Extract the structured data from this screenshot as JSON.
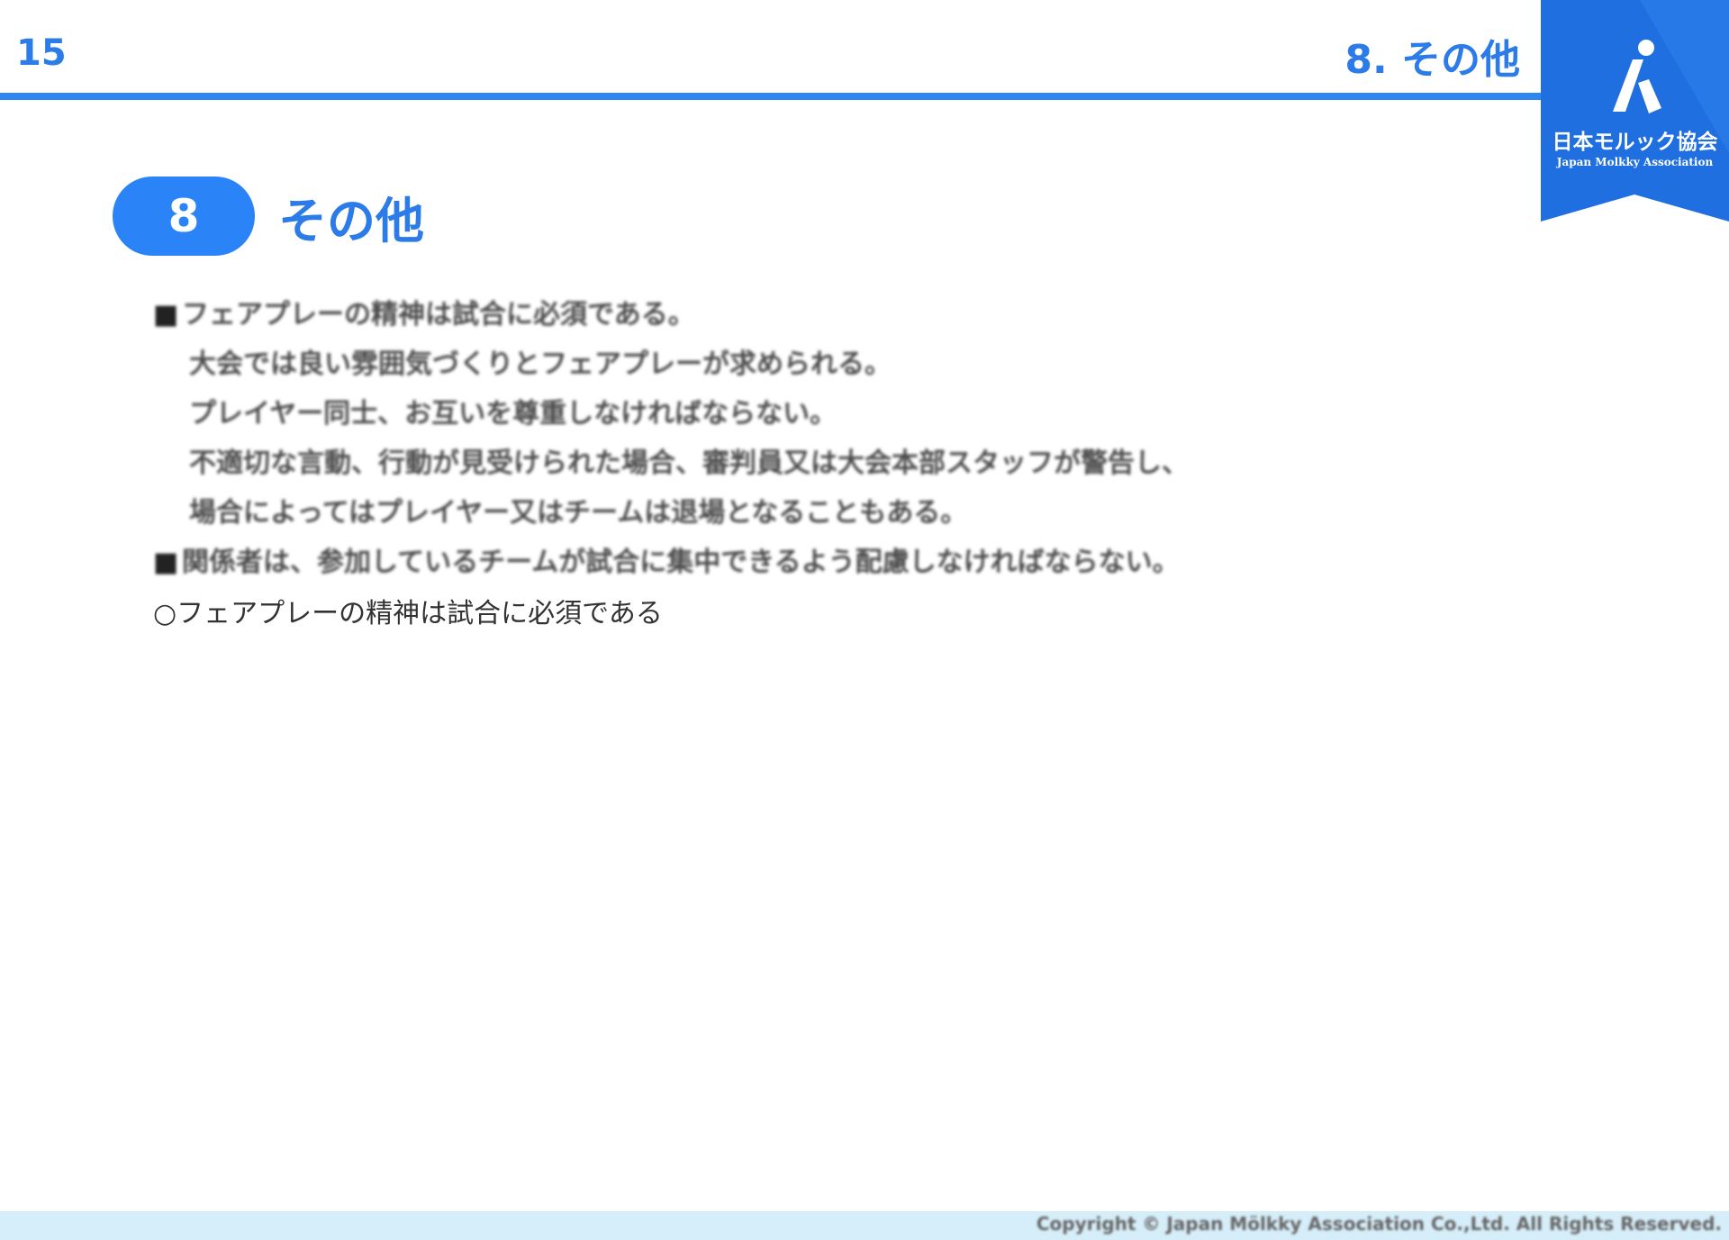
{
  "header": {
    "page_number": "15",
    "title": "8. その他"
  },
  "logo": {
    "name": "日本モルック協会",
    "subtitle": "Japan Molkky Association"
  },
  "section": {
    "number": "8",
    "title": "その他"
  },
  "body": {
    "bullet_glyph": "■",
    "lines": [
      "フェアプレーの精神は試合に必須である。",
      "大会では良い雰囲気づくりとフェアプレーが求められる。",
      "プレイヤー同士、お互いを尊重しなければならない。",
      "不適切な言動、行動が見受けられた場合、審判員又は大会本部スタッフが警告し、",
      "場合によってはプレイヤー又はチームは退場となることもある。",
      "関係者は、参加しているチームが試合に集中できるよう配慮しなければならない。"
    ],
    "overflow_line": "○フェアプレーの精神は試合に必須である"
  },
  "footer": {
    "copyright": "Copyright © Japan Mölkky Association Co.,Ltd. All Rights Reserved."
  },
  "colors": {
    "accent": "#2b7be8",
    "rule": "#2e86f0",
    "badge": "#2b84f7",
    "logo_banner": "#1f6fe0",
    "footer_bar": "#d6eef9"
  }
}
